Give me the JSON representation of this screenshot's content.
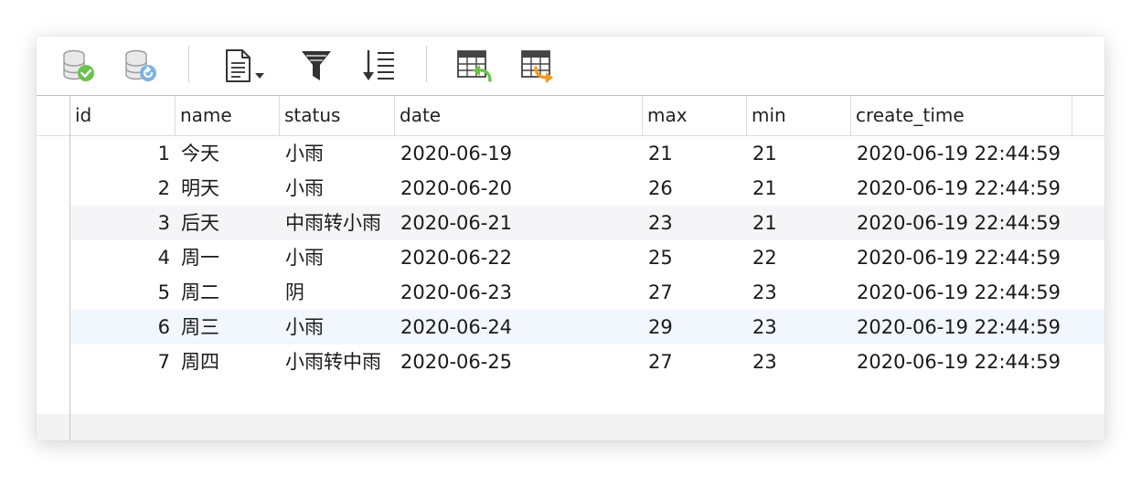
{
  "toolbar": {
    "buttons": [
      {
        "name": "commit-icon",
        "tooltip": ""
      },
      {
        "name": "rollback-icon",
        "tooltip": ""
      },
      {
        "name": "text-view-icon",
        "tooltip": ""
      },
      {
        "name": "filter-icon",
        "tooltip": ""
      },
      {
        "name": "sort-icon",
        "tooltip": ""
      },
      {
        "name": "import-icon",
        "tooltip": ""
      },
      {
        "name": "export-icon",
        "tooltip": ""
      }
    ],
    "colors": {
      "green": "#6cc24a",
      "blue": "#5aa0d8",
      "orange": "#f39a1e",
      "dark": "#333333"
    }
  },
  "table": {
    "columns": [
      "id",
      "name",
      "status",
      "date",
      "max",
      "min",
      "create_time"
    ],
    "rows": [
      [
        "1",
        "今天",
        "小雨",
        "2020-06-19",
        "21",
        "21",
        "2020-06-19 22:44:59"
      ],
      [
        "2",
        "明天",
        "小雨",
        "2020-06-20",
        "26",
        "21",
        "2020-06-19 22:44:59"
      ],
      [
        "3",
        "后天",
        "中雨转小雨",
        "2020-06-21",
        "23",
        "21",
        "2020-06-19 22:44:59"
      ],
      [
        "4",
        "周一",
        "小雨",
        "2020-06-22",
        "25",
        "22",
        "2020-06-19 22:44:59"
      ],
      [
        "5",
        "周二",
        "阴",
        "2020-06-23",
        "27",
        "23",
        "2020-06-19 22:44:59"
      ],
      [
        "6",
        "周三",
        "小雨",
        "2020-06-24",
        "29",
        "23",
        "2020-06-19 22:44:59"
      ],
      [
        "7",
        "周四",
        "小雨转中雨",
        "2020-06-25",
        "27",
        "23",
        "2020-06-19 22:44:59"
      ]
    ]
  }
}
